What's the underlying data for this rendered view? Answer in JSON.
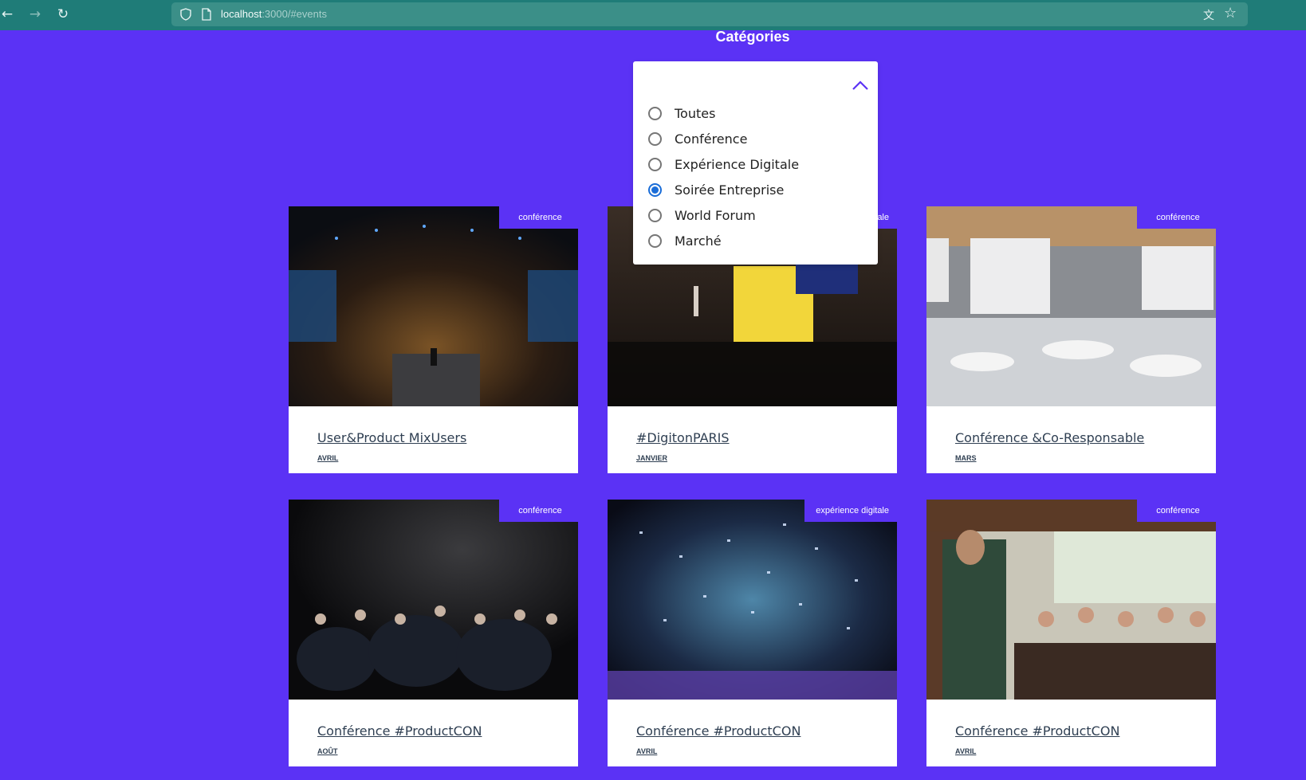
{
  "browser": {
    "url_host": "localhost",
    "url_path": ":3000/#events",
    "icons": [
      "back-icon",
      "forward-icon",
      "reload-icon",
      "shield-icon",
      "page-icon",
      "translate-icon",
      "star-icon"
    ]
  },
  "page": {
    "section_title": "Catégories",
    "accent_color": "#5b32f5"
  },
  "filter": {
    "options": [
      {
        "label": "Toutes",
        "checked": false
      },
      {
        "label": "Conférence",
        "checked": false
      },
      {
        "label": "Expérience Digitale",
        "checked": false
      },
      {
        "label": "Soirée Entreprise",
        "checked": true
      },
      {
        "label": "World Forum",
        "checked": false
      },
      {
        "label": "Marché",
        "checked": false
      }
    ]
  },
  "events": [
    {
      "badge": "conférence",
      "title": "User&Product MixUsers",
      "month": "AVRIL"
    },
    {
      "badge": "expérience digitale",
      "title": "#DigitonPARIS",
      "month": "JANVIER"
    },
    {
      "badge": "conférence",
      "title": "Conférence &Co-Responsable",
      "month": "MARS"
    },
    {
      "badge": "conférence",
      "title": "Conférence #ProductCON",
      "month": "AOÛT"
    },
    {
      "badge": "expérience digitale",
      "title": "Conférence #ProductCON",
      "month": "AVRIL"
    },
    {
      "badge": "conférence",
      "title": "Conférence #ProductCON",
      "month": "AVRIL"
    }
  ]
}
